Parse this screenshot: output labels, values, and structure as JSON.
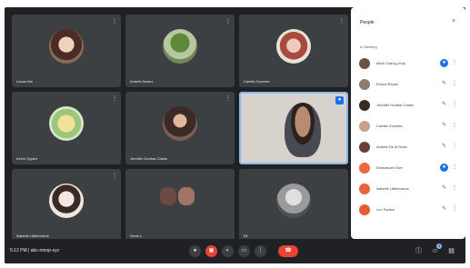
{
  "meeting": {
    "time": "5:12 PM",
    "separator": "|",
    "code": "abc-mnop-xyz"
  },
  "tiles": [
    {
      "name": "Laura Kim"
    },
    {
      "name": "Andrés Nunez"
    },
    {
      "name": "Camila Guzmán"
    },
    {
      "name": "Kevin Ogden"
    },
    {
      "name": "Jennifer Dunbar-Clarke"
    },
    {
      "name": ""
    },
    {
      "name": "Isabelle Littlebourne"
    },
    {
      "name": "Omar L."
    },
    {
      "name": "Eli"
    }
  ],
  "panel": {
    "title": "People",
    "section": "In Meeting",
    "people": [
      {
        "name": "Mark Chang (You)",
        "mic_active": true
      },
      {
        "name": "Emma Reyes",
        "mic_active": false
      },
      {
        "name": "Jennifer Dunbar-Clarke",
        "mic_active": false
      },
      {
        "name": "Camila Guzmán",
        "mic_active": false
      },
      {
        "name": "Andrés De la Rosa",
        "mic_active": false
      },
      {
        "name": "Emmanuel Osei",
        "mic_active": true
      },
      {
        "name": "Isabelle Littlebourne",
        "mic_active": false
      },
      {
        "name": "Leo Santos",
        "mic_active": false
      }
    ]
  },
  "controls": {
    "participant_count": "9"
  },
  "colors": {
    "background": "#202124",
    "tile": "#3c4043",
    "accent": "#1a73e8",
    "end_call": "#ea4335"
  },
  "icons": {
    "mic": "mic-icon",
    "mic_off": "mic-off-icon",
    "camera": "camera-icon",
    "captions": "captions-icon",
    "present": "present-icon",
    "more": "more-vert-icon",
    "hangup": "call-end-icon",
    "info": "info-icon",
    "people": "people-icon",
    "chat": "chat-icon",
    "close": "close-icon"
  }
}
